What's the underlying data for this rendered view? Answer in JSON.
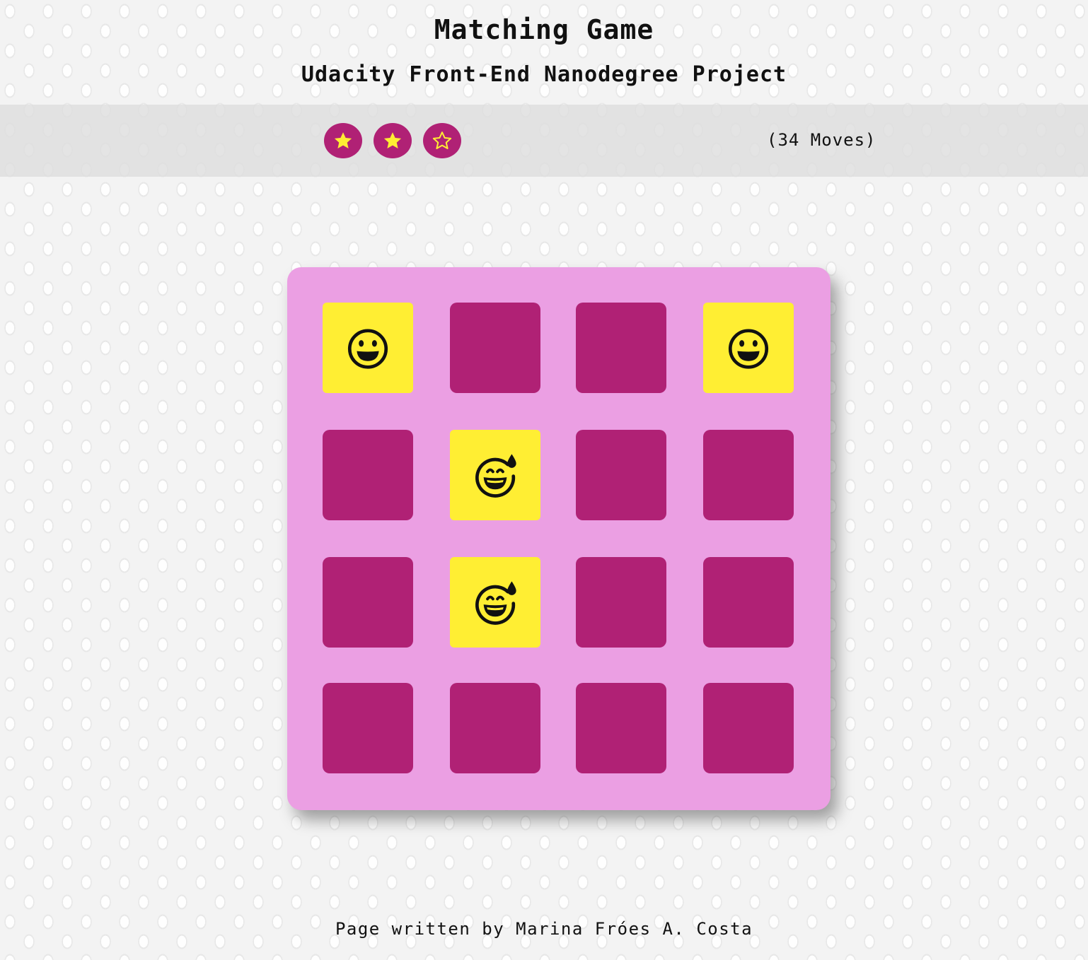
{
  "header": {
    "title": "Matching Game",
    "subtitle": "Udacity Front-End Nanodegree Project"
  },
  "score_panel": {
    "stars": [
      {
        "icon": "star-filled-icon",
        "filled": true
      },
      {
        "icon": "star-filled-icon",
        "filled": true
      },
      {
        "icon": "star-outline-icon",
        "filled": false
      }
    ],
    "moves_label": "(34 Moves)"
  },
  "deck": {
    "columns": 4,
    "rows": 4,
    "cards": [
      {
        "state": "open",
        "icon": "grinning-face-icon"
      },
      {
        "state": "closed",
        "icon": null
      },
      {
        "state": "closed",
        "icon": null
      },
      {
        "state": "open",
        "icon": "grinning-face-icon"
      },
      {
        "state": "closed",
        "icon": null
      },
      {
        "state": "open",
        "icon": "grinning-face-sweat-icon"
      },
      {
        "state": "closed",
        "icon": null
      },
      {
        "state": "closed",
        "icon": null
      },
      {
        "state": "closed",
        "icon": null
      },
      {
        "state": "open",
        "icon": "grinning-face-sweat-icon"
      },
      {
        "state": "closed",
        "icon": null
      },
      {
        "state": "closed",
        "icon": null
      },
      {
        "state": "closed",
        "icon": null
      },
      {
        "state": "closed",
        "icon": null
      },
      {
        "state": "closed",
        "icon": null
      },
      {
        "state": "closed",
        "icon": null
      }
    ]
  },
  "footer": {
    "credit": "Page written by Marina Fróes A. Costa"
  },
  "colors": {
    "deck_background": "#eb9fe3",
    "card_closed": "#b02175",
    "card_open": "#ffee33",
    "star_badge": "#b02175",
    "star_fill": "#ffee33"
  }
}
